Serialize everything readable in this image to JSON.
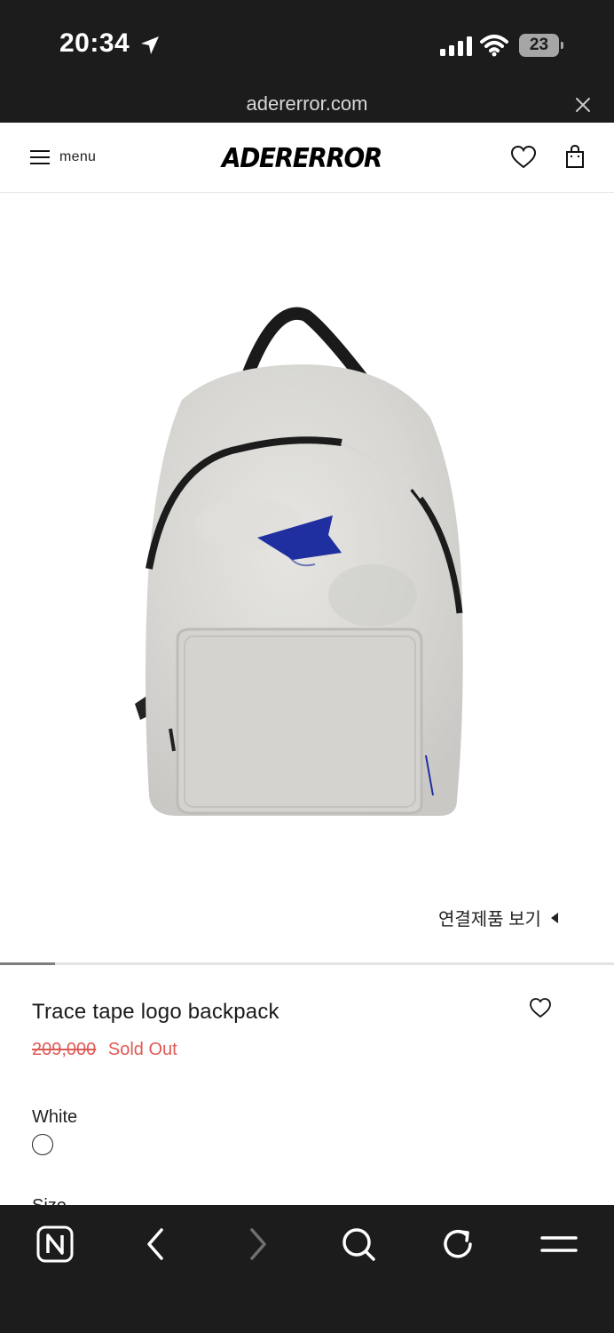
{
  "status_bar": {
    "time": "20:34",
    "battery": "23",
    "icons": [
      "location-arrow-icon",
      "cellular-signal-icon",
      "wifi-icon",
      "battery-icon"
    ]
  },
  "browser": {
    "url": "adererror.com",
    "close_icon": "close-icon"
  },
  "header": {
    "menu_label": "menu",
    "logo": "ADERERROR",
    "icons": [
      "hamburger-icon",
      "heart-icon",
      "shopping-bag-icon"
    ]
  },
  "product": {
    "image_icon": "backpack-image",
    "related_link": "연결제품 보기",
    "slider_progress": 0.09,
    "title": "Trace tape logo backpack",
    "price_original": "209,000",
    "status": "Sold Out",
    "color_name": "White",
    "size_label": "Size"
  },
  "toolbar": {
    "items": [
      "naver-home-icon",
      "back-icon",
      "forward-icon",
      "search-icon",
      "reload-icon",
      "menu-icon"
    ]
  },
  "colors": {
    "dark_bar": "#1c1c1c",
    "sale_red": "#e05a55",
    "backpack_blue": "#1f2fa0"
  }
}
